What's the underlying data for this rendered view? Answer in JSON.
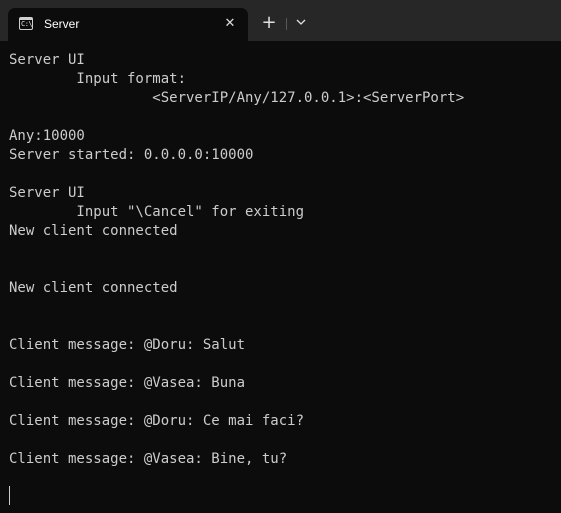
{
  "tab": {
    "title": "Server",
    "icon": "terminal-icon",
    "icon_glyph": "C:\\",
    "close_glyph": "✕"
  },
  "toolbar": {
    "new_tab_glyph": "+",
    "dropdown_icon": "chevron-down-icon"
  },
  "colors": {
    "background": "#0c0c0c",
    "titlebar": "#272727",
    "text": "#cccccc"
  },
  "terminal": {
    "lines": [
      "Server UI",
      "        Input format:",
      "                 <ServerIP/Any/127.0.0.1>:<ServerPort>",
      "",
      "Any:10000",
      "Server started: 0.0.0.0:10000",
      "",
      "Server UI",
      "        Input \"\\Cancel\" for exiting",
      "New client connected",
      "",
      "",
      "New client connected",
      "",
      "",
      "Client message: @Doru: Salut",
      "",
      "Client message: @Vasea: Buna",
      "",
      "Client message: @Doru: Ce mai faci?",
      "",
      "Client message: @Vasea: Bine, tu?",
      ""
    ]
  }
}
